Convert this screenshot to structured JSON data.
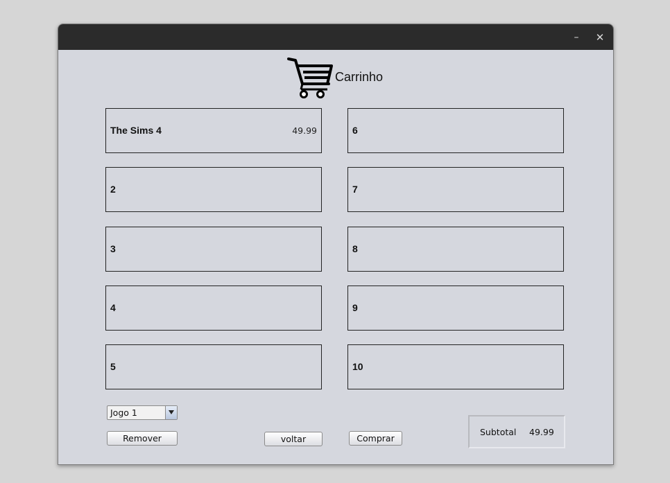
{
  "window": {
    "minimize_label": "–",
    "close_label": "✕"
  },
  "header": {
    "title": "Carrinho",
    "icon": "shopping-cart-icon"
  },
  "slots": [
    {
      "name": "The Sims 4",
      "price": "49.99"
    },
    {
      "name": "2",
      "price": ""
    },
    {
      "name": "3",
      "price": ""
    },
    {
      "name": "4",
      "price": ""
    },
    {
      "name": "5",
      "price": ""
    },
    {
      "name": "6",
      "price": ""
    },
    {
      "name": "7",
      "price": ""
    },
    {
      "name": "8",
      "price": ""
    },
    {
      "name": "9",
      "price": ""
    },
    {
      "name": "10",
      "price": ""
    }
  ],
  "select": {
    "value": "Jogo 1"
  },
  "buttons": {
    "remove": "Remover",
    "back": "voltar",
    "buy": "Comprar"
  },
  "subtotal": {
    "label": "Subtotal",
    "value": "49.99"
  }
}
